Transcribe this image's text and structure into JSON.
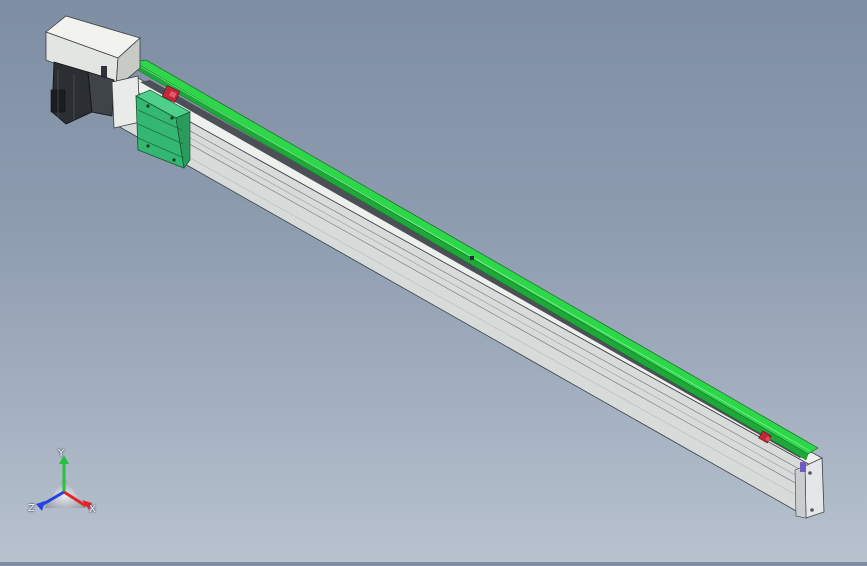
{
  "viewport": {
    "background_top": "#7e8ea3",
    "background_bottom": "#b8c2cf",
    "model": {
      "description_parts": [
        "motor-housing",
        "servo-motor",
        "linear-rail-body",
        "guide-rail",
        "carriage-slider",
        "end-cap",
        "limit-sensor-front",
        "limit-sensor-rear"
      ],
      "colors": {
        "rail_body": "#dde1e0",
        "guide_rail": "#2ed64a",
        "carriage": "#35b774",
        "motor": "#2b2f33",
        "housing": "#e3e5e1",
        "sensor": "#c0283a"
      }
    }
  },
  "triad": {
    "x_label": "X",
    "y_label": "Y",
    "z_label": "Z",
    "x_color": "#e0262b",
    "y_color": "#27c23d",
    "z_color": "#2742e0"
  }
}
